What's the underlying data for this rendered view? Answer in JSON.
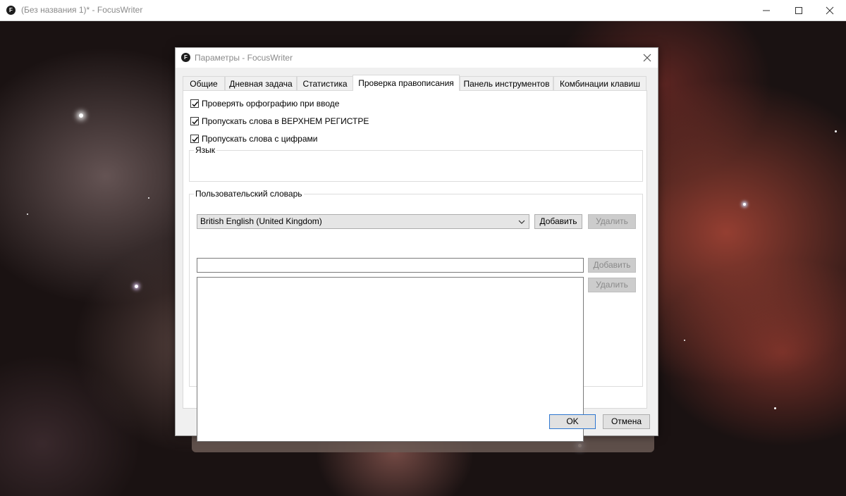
{
  "window": {
    "title": "(Без названия 1)* - FocusWriter",
    "icon_letter": "F"
  },
  "dialog": {
    "title": "Параметры - FocusWriter",
    "icon_letter": "F",
    "tabs": [
      {
        "label": "Общие",
        "active": false
      },
      {
        "label": "Дневная задача",
        "active": false
      },
      {
        "label": "Статистика",
        "active": false
      },
      {
        "label": "Проверка правописания",
        "active": true
      },
      {
        "label": "Панель инструментов",
        "active": false
      },
      {
        "label": "Комбинации клавиш",
        "active": false
      }
    ],
    "spelling": {
      "options": [
        {
          "label": "Проверять орфографию при вводе",
          "checked": true
        },
        {
          "label": "Пропускать слова в ВЕРХНЕМ РЕГИСТРЕ",
          "checked": true
        },
        {
          "label": "Пропускать слова с цифрами",
          "checked": true
        }
      ],
      "language_group": {
        "label": "Язык",
        "selected": "British English (United Kingdom)",
        "add_label": "Добавить",
        "remove_label": "Удалить"
      },
      "dictionary_group": {
        "label": "Пользовательский словарь",
        "input_value": "",
        "add_label": "Добавить",
        "remove_label": "Удалить",
        "words": []
      }
    },
    "ok_label": "OK",
    "cancel_label": "Отмена"
  }
}
